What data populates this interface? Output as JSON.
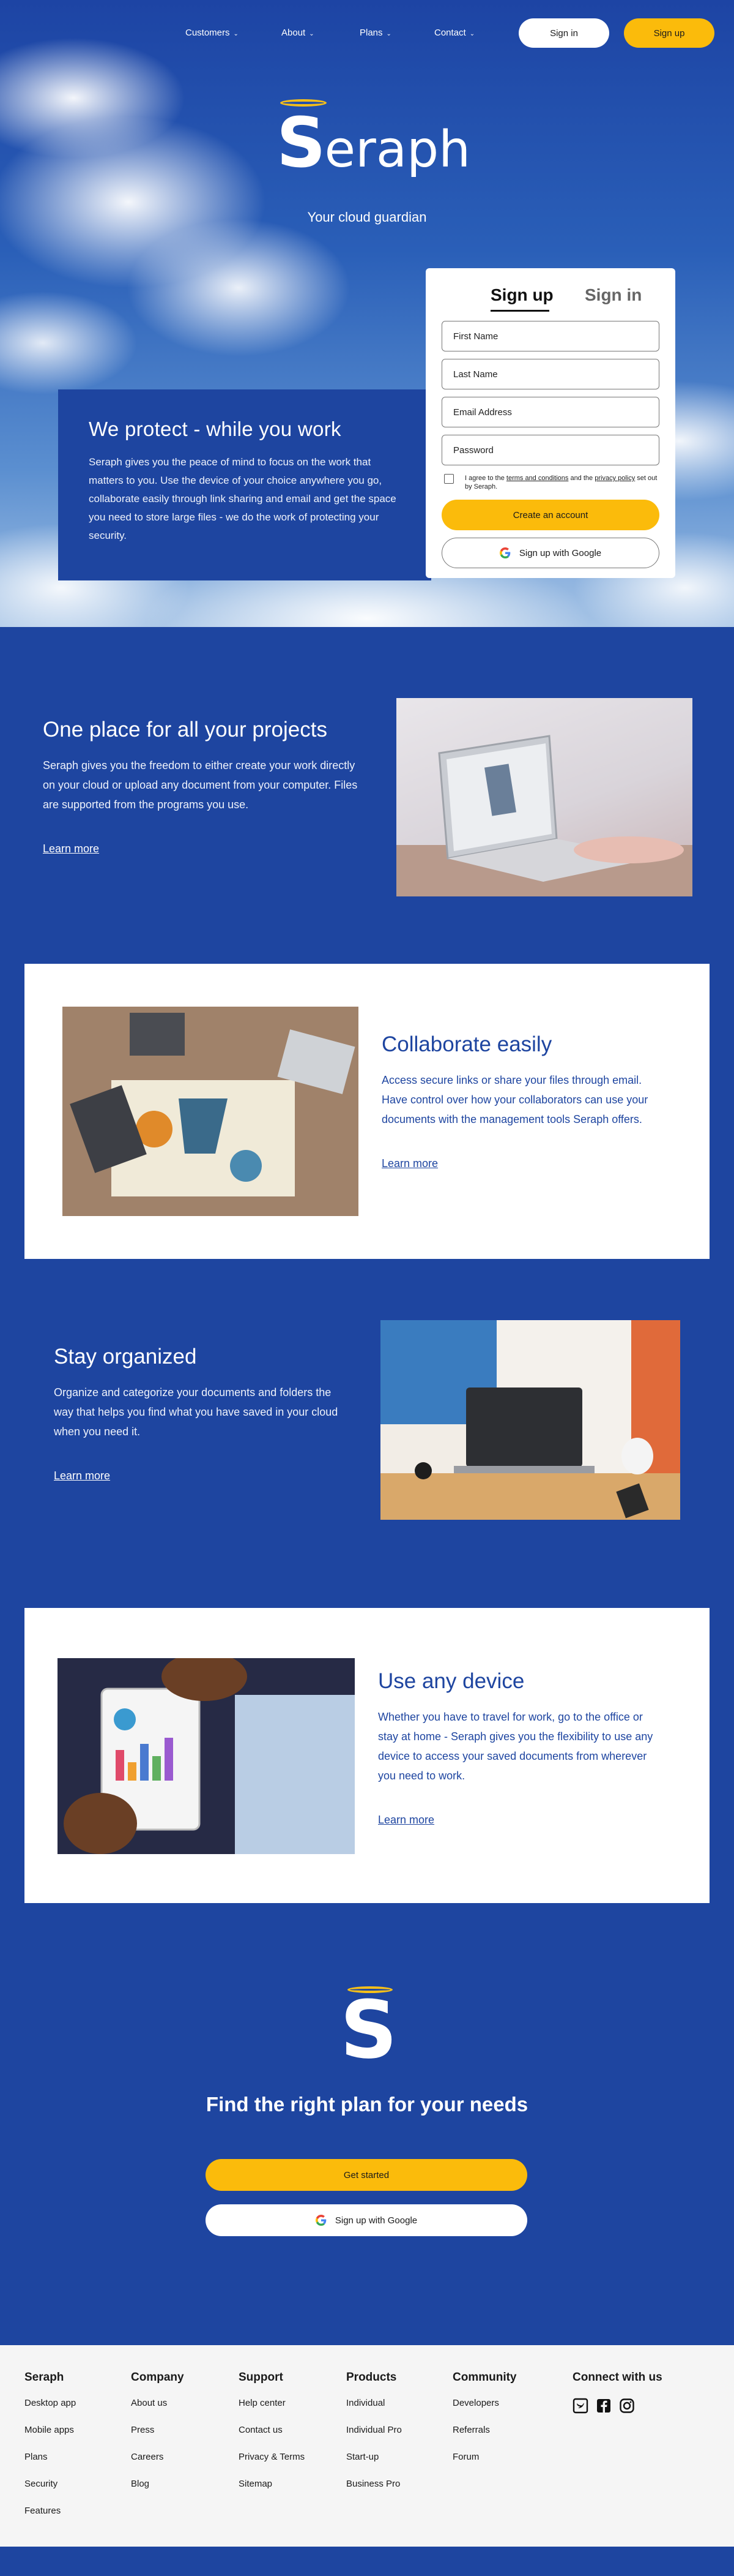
{
  "nav": {
    "items": [
      {
        "label": "Customers"
      },
      {
        "label": "About"
      },
      {
        "label": "Plans"
      },
      {
        "label": "Contact"
      }
    ],
    "sign_in": "Sign in",
    "sign_up": "Sign up"
  },
  "brand": {
    "name_initial": "S",
    "name_rest": "eraph",
    "tagline": "Your cloud guardian",
    "halo_color": "#f5bf1a"
  },
  "protect": {
    "title": "We protect - while you work",
    "body": "Seraph gives you the peace of mind to focus on the work that matters to you. Use the device of your choice anywhere you go, collaborate easily through link sharing and email and get the space you need to store large files - we do the work of protecting your security."
  },
  "form": {
    "tab_signup": "Sign up",
    "tab_signin": "Sign in",
    "first_name": "First Name",
    "last_name": "Last Name",
    "email": "Email Address",
    "password": "Password",
    "agree_prefix": "I agree to the ",
    "terms": "terms and conditions",
    "agree_mid": " and the ",
    "privacy": "privacy policy",
    "agree_suffix": " set out by Seraph.",
    "create_button": "Create an account",
    "google_button": "Sign up with Google"
  },
  "sections": [
    {
      "title": "One place for all your projects",
      "body": "Seraph gives you the freedom to either create your work directly on your cloud or upload any document from your computer. Files are supported from the programs you use.",
      "link": "Learn more"
    },
    {
      "title": "Collaborate easily",
      "body": "Access secure links or share your files through email. Have control over how your collaborators can use your documents with the management tools Seraph offers.",
      "link": "Learn more"
    },
    {
      "title": "Stay organized",
      "body": "Organize and categorize your documents and folders the way that helps you find what you have saved in your cloud when you need it.",
      "link": "Learn more"
    },
    {
      "title": "Use any device",
      "body": "Whether you have to travel for work, go to the office or stay at home - Seraph gives you the flexibility to use any device to access your saved documents from wherever you need to work.",
      "link": "Learn more"
    }
  ],
  "plan": {
    "logo_letter": "S",
    "title": "Find the right plan for your needs",
    "get_started": "Get started",
    "google_button": "Sign up with Google"
  },
  "footer": {
    "columns": [
      {
        "title": "Seraph",
        "links": [
          "Desktop app",
          "Mobile apps",
          "Plans",
          "Security",
          "Features"
        ]
      },
      {
        "title": "Company",
        "links": [
          "About us",
          "Press",
          "Careers",
          "Blog"
        ]
      },
      {
        "title": "Support",
        "links": [
          "Help center",
          "Contact us",
          "Privacy & Terms",
          "Sitemap"
        ]
      },
      {
        "title": "Products",
        "links": [
          "Individual",
          "Individual Pro",
          "Start-up",
          "Business Pro"
        ]
      },
      {
        "title": "Community",
        "links": [
          "Developers",
          "Referrals",
          "Forum"
        ]
      }
    ],
    "connect_title": "Connect with us",
    "social_icons": [
      "twitter-icon",
      "facebook-icon",
      "instagram-icon"
    ]
  },
  "colors": {
    "brand_blue": "#1e45a0",
    "accent_yellow": "#fbbb0b",
    "footer_bg": "#f5f5f5"
  }
}
